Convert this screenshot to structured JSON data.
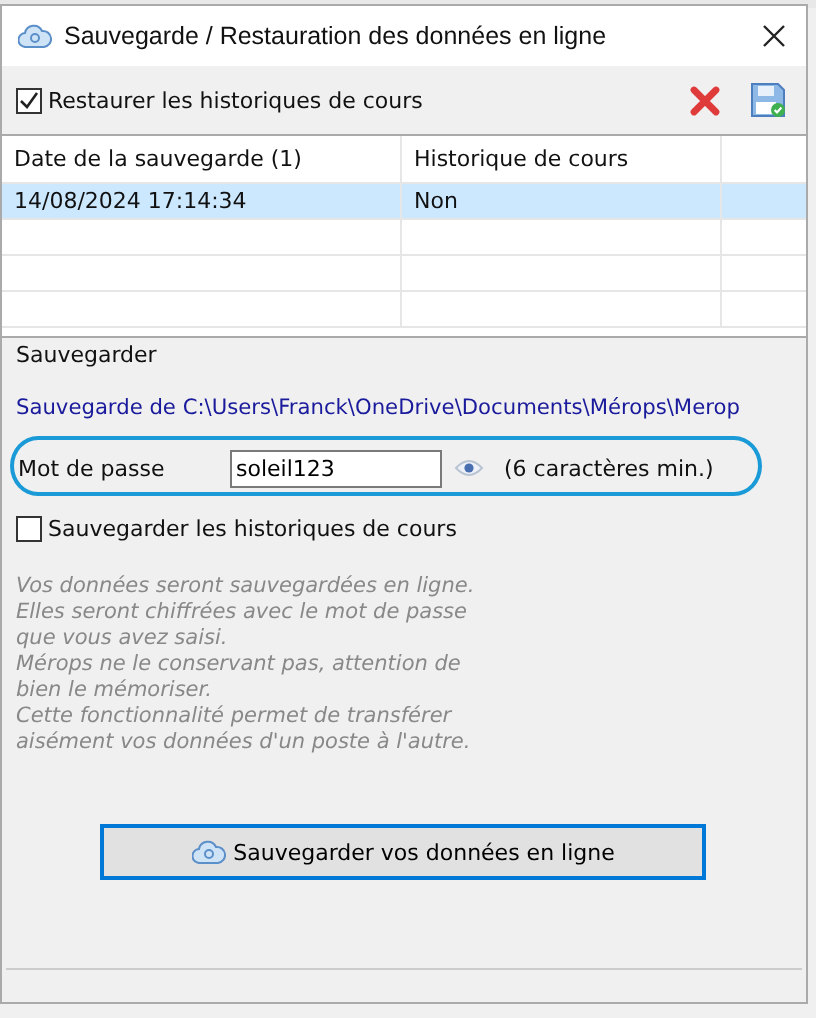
{
  "window": {
    "title": "Sauvegarde / Restauration des données en ligne"
  },
  "restore": {
    "label": "Restaurer les historiques de cours",
    "checked": true
  },
  "table": {
    "columns": [
      "Date de la sauvegarde (1)",
      "Historique de cours"
    ],
    "rows": [
      {
        "cells": [
          "14/08/2024 17:14:34",
          "Non"
        ],
        "selected": true
      }
    ]
  },
  "backup": {
    "group_title": "Sauvegarder",
    "source": "Sauvegarde de C:\\Users\\Franck\\OneDrive\\Documents\\Mérops\\Merop",
    "password": {
      "label": "Mot de passe",
      "value": "soleil123",
      "hint": "(6 caractères min.)"
    },
    "history": {
      "label": "Sauvegarder les historiques de cours",
      "checked": false
    },
    "notes": [
      "Vos données seront sauvegardées en ligne.",
      "Elles seront chiffrées avec le mot de passe",
      "que vous avez saisi.",
      "Mérops ne le conservant pas, attention de",
      "bien le mémoriser.",
      "Cette fonctionnalité permet de transférer",
      "aisément vos données d'un poste à l'autre."
    ],
    "button": "Sauvegarder vos données en ligne"
  }
}
